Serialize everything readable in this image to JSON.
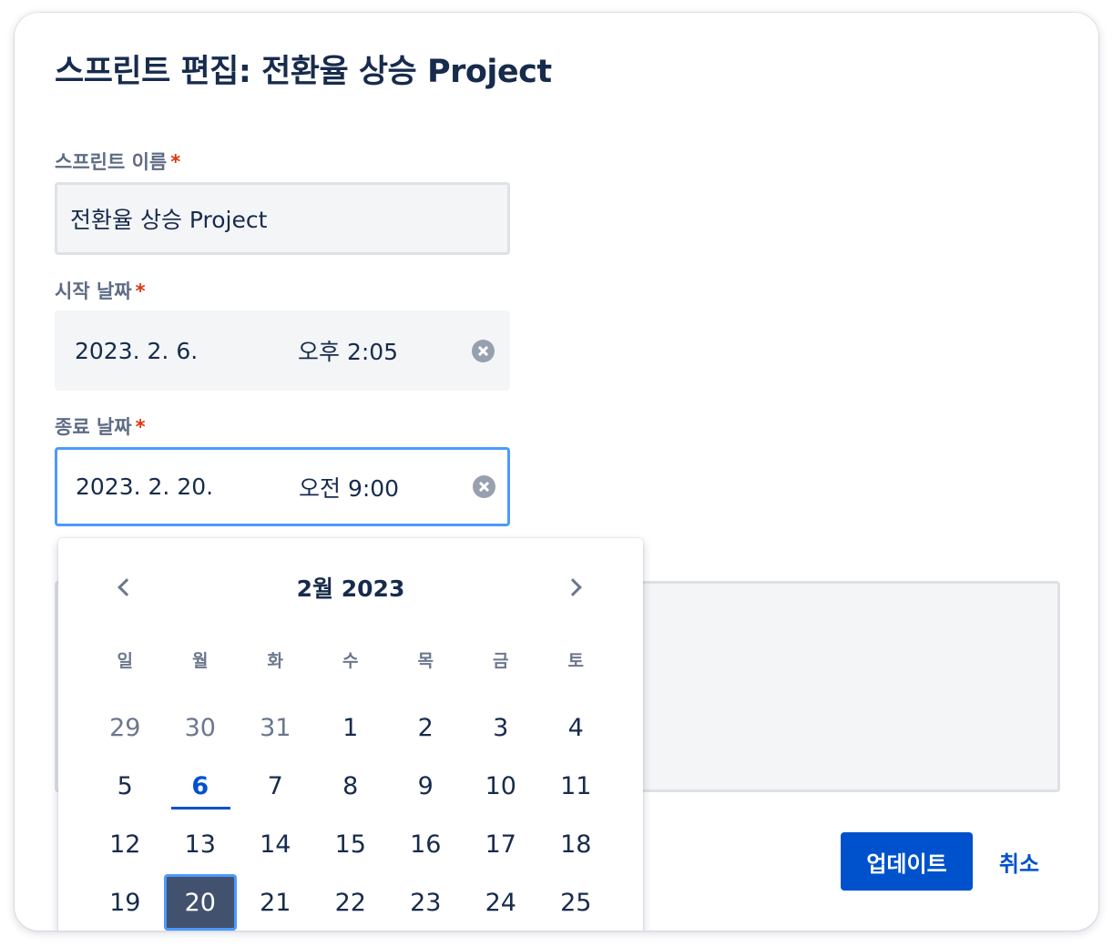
{
  "dialog": {
    "title": "스프린트 편집: 전환율 상승 Project"
  },
  "form": {
    "name": {
      "label": "스프린트 이름",
      "required_mark": "*",
      "value": "전환율 상승 Project"
    },
    "start": {
      "label": "시작 날짜",
      "required_mark": "*",
      "date": "2023. 2. 6.",
      "time": "오후 2:05"
    },
    "end": {
      "label": "종료 날짜",
      "required_mark": "*",
      "date": "2023. 2. 20.",
      "time": "오전 9:00"
    },
    "goal": {
      "label": ""
    }
  },
  "buttons": {
    "update": "업데이트",
    "cancel": "취소"
  },
  "calendar": {
    "month_label": "2월 2023",
    "weekdays": [
      "일",
      "월",
      "화",
      "수",
      "목",
      "금",
      "토"
    ],
    "days": [
      {
        "d": "29",
        "state": "muted"
      },
      {
        "d": "30",
        "state": "muted"
      },
      {
        "d": "31",
        "state": "muted"
      },
      {
        "d": "1",
        "state": ""
      },
      {
        "d": "2",
        "state": ""
      },
      {
        "d": "3",
        "state": ""
      },
      {
        "d": "4",
        "state": ""
      },
      {
        "d": "5",
        "state": ""
      },
      {
        "d": "6",
        "state": "today"
      },
      {
        "d": "7",
        "state": ""
      },
      {
        "d": "8",
        "state": ""
      },
      {
        "d": "9",
        "state": ""
      },
      {
        "d": "10",
        "state": ""
      },
      {
        "d": "11",
        "state": ""
      },
      {
        "d": "12",
        "state": ""
      },
      {
        "d": "13",
        "state": ""
      },
      {
        "d": "14",
        "state": ""
      },
      {
        "d": "15",
        "state": ""
      },
      {
        "d": "16",
        "state": ""
      },
      {
        "d": "17",
        "state": ""
      },
      {
        "d": "18",
        "state": ""
      },
      {
        "d": "19",
        "state": ""
      },
      {
        "d": "20",
        "state": "selected"
      },
      {
        "d": "21",
        "state": ""
      },
      {
        "d": "22",
        "state": ""
      },
      {
        "d": "23",
        "state": ""
      },
      {
        "d": "24",
        "state": ""
      },
      {
        "d": "25",
        "state": ""
      }
    ]
  },
  "colors": {
    "primary": "#0052cc",
    "focus_border": "#4c9aff",
    "required": "#de350b",
    "selected_day_bg": "#42526e"
  },
  "icons": [
    "clear-icon",
    "chevron-left-icon",
    "chevron-right-icon"
  ]
}
